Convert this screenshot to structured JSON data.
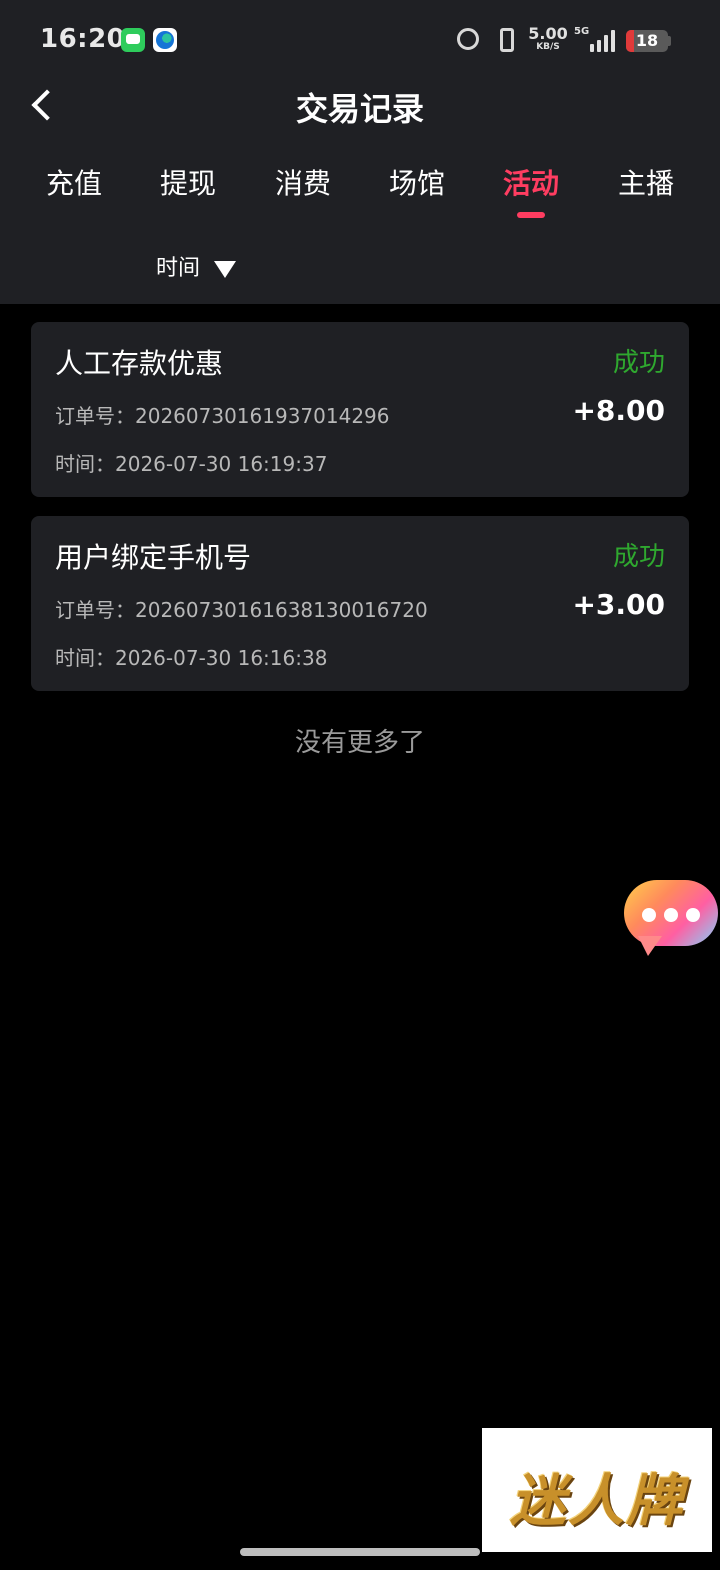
{
  "status_bar": {
    "time": "16:20",
    "net_speed_value": "5.00",
    "net_speed_unit": "KB/S",
    "network": "5G",
    "battery": "18",
    "battery_level_percent": 18,
    "icons": [
      "messages-app-icon",
      "edge-browser-icon",
      "alarm-icon",
      "vibrate-icon",
      "signal-icon",
      "battery-icon"
    ]
  },
  "header": {
    "title": "交易记录"
  },
  "tabs": [
    {
      "label": "充值",
      "active": false
    },
    {
      "label": "提现",
      "active": false
    },
    {
      "label": "消费",
      "active": false
    },
    {
      "label": "场馆",
      "active": false
    },
    {
      "label": "活动",
      "active": true
    },
    {
      "label": "主播",
      "active": false
    }
  ],
  "filter": {
    "label": "时间"
  },
  "records": [
    {
      "name": "人工存款优惠",
      "status": "成功",
      "order_label": "订单号：",
      "order_no": "2026073016193701429 6",
      "amount": "+8.00",
      "time_label": "时间：",
      "time": "2026-07-30 16:19:37"
    },
    {
      "name": "用户绑定手机号",
      "status": "成功",
      "order_label": "订单号：",
      "order_no": "20260730161638130016720",
      "amount": "+3.00",
      "time_label": "时间：",
      "time": "2026-07-30 16:16:38"
    }
  ],
  "footer_text": "没有更多了",
  "watermark": {
    "text": "迷人牌"
  },
  "colors": {
    "accent": "#ff3d61",
    "success": "#2fa82f",
    "surface": "#1f2024",
    "background": "#000000"
  }
}
